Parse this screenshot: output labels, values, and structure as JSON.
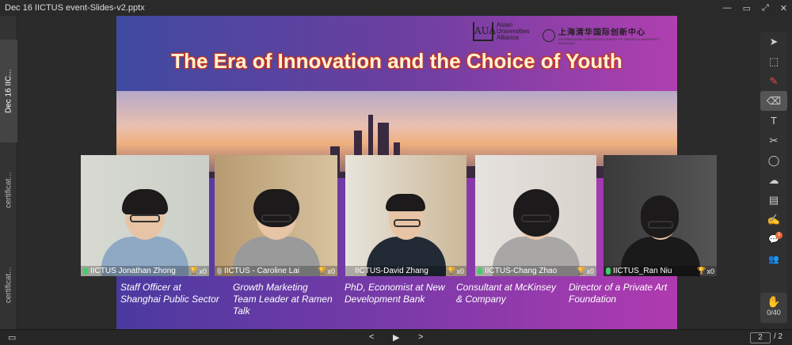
{
  "window": {
    "title": "Dec 16 IICTUS event-Slides-v2.pptx",
    "controls": [
      "—",
      "▭",
      "⤢",
      "✕"
    ]
  },
  "left_rail": {
    "tabs": [
      {
        "label": "Dec 16 IIC..."
      },
      {
        "label": "certificat..."
      },
      {
        "label": "certificat..."
      }
    ]
  },
  "slide": {
    "logo_aua": {
      "mark": "AUA",
      "lines": [
        "Asian",
        "Universities",
        "Alliance"
      ]
    },
    "logo_cn": {
      "text": "上海清华国际创新中心",
      "subtext": "INTERNATIONAL INNOVATION CENTER OF TSINGHUA UNIVERSITY, SHANGHAI"
    },
    "title": "The Era of Innovation and the Choice of Youth",
    "participants": [
      {
        "name": "IICTUS Jonathan Zhong",
        "score": "x0",
        "role_lines": [
          "Staff Officer at",
          "Shanghai Public Sector"
        ],
        "mic": "on"
      },
      {
        "name": "IICTUS - Caroline Lai",
        "score": "x0",
        "role_lines": [
          "Growth Marketing",
          "Team Leader at Ramen",
          "Talk"
        ],
        "mic": "off"
      },
      {
        "name": "IICTUS-David Zhang",
        "score": "x0",
        "role_lines": [
          "PhD, Economist at New",
          "Development Bank"
        ],
        "mic": "off"
      },
      {
        "name": "IICTUS-Chang Zhao",
        "score": "x0",
        "role_lines": [
          "Consultant at McKinsey",
          "& Company"
        ],
        "mic": "on"
      },
      {
        "name": "IICTUS_Ran Niu",
        "score": "x0",
        "role_lines": [
          "Director of a Private Art",
          "Foundation"
        ],
        "mic": "on"
      }
    ]
  },
  "toolbar": {
    "tools": [
      {
        "icon": "pointer-icon",
        "glyph": "➤"
      },
      {
        "icon": "laser-select-icon",
        "glyph": "⬚"
      },
      {
        "icon": "marker-icon",
        "glyph": "✎"
      },
      {
        "icon": "eraser-icon",
        "glyph": "⌫"
      },
      {
        "icon": "text-icon",
        "glyph": "T"
      },
      {
        "icon": "scissors-icon",
        "glyph": "✂"
      },
      {
        "icon": "shape-icon",
        "glyph": "◯"
      },
      {
        "icon": "cloud-icon",
        "glyph": "☁"
      },
      {
        "icon": "toolbox-icon",
        "glyph": "▤"
      },
      {
        "icon": "edit-icon",
        "glyph": "✍"
      },
      {
        "icon": "chat-icon",
        "glyph": "💬",
        "badge": "3"
      },
      {
        "icon": "participants-icon",
        "glyph": "👥"
      }
    ],
    "raise_hand_count": "0/40"
  },
  "bottombar": {
    "prev": "<",
    "play": "▶",
    "next": ">",
    "page_current": "2",
    "page_total": "/ 2"
  }
}
